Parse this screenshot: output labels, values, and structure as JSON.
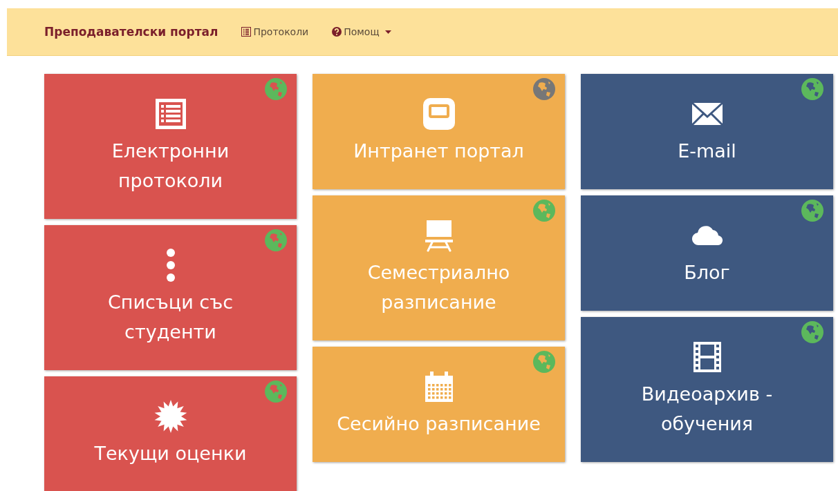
{
  "navbar": {
    "brand": "Преподавателски портал",
    "links": [
      {
        "label": "Протоколи",
        "kind": "list",
        "dropdown": false
      },
      {
        "label": "Помощ",
        "kind": "question",
        "dropdown": true
      }
    ]
  },
  "columns": [
    {
      "color": "#d9534f",
      "tiles": [
        {
          "kind": "list",
          "label": "Електронни протоколи",
          "color": "#5cb85c"
        },
        {
          "kind": "dots",
          "label": "Списъци със студенти",
          "color": "#5cb85c"
        },
        {
          "kind": "burst",
          "label": "Текущи оценки",
          "color": "#5cb85c"
        }
      ]
    },
    {
      "color": "#f0ad4e",
      "tiles": [
        {
          "kind": "portal",
          "label": "Интранет портал",
          "color": "#777777"
        },
        {
          "kind": "board",
          "label": "Семестриално разписание",
          "color": "#5cb85c"
        },
        {
          "kind": "calendar",
          "label": "Сесийно разписание",
          "color": "#5cb85c"
        }
      ]
    },
    {
      "color": "#3e5880",
      "tiles": [
        {
          "kind": "mail",
          "label": "E-mail",
          "color": "#5cb85c"
        },
        {
          "kind": "cloud",
          "label": "Блог",
          "color": "#5cb85c"
        },
        {
          "kind": "film",
          "label": "Видеоархив - обучения",
          "color": "#5cb85c"
        }
      ]
    }
  ]
}
